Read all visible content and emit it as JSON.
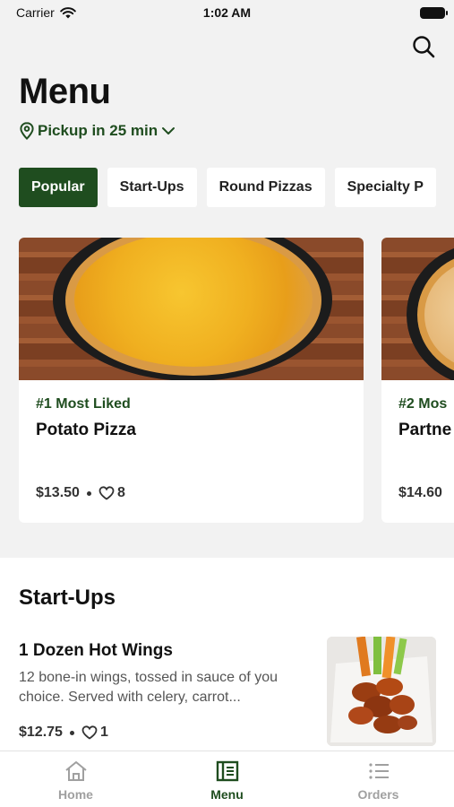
{
  "status_bar": {
    "carrier": "Carrier",
    "time": "1:02 AM"
  },
  "header": {
    "title": "Menu",
    "pickup_label": "Pickup in 25 min"
  },
  "categories": [
    {
      "label": "Popular",
      "active": true
    },
    {
      "label": "Start-Ups",
      "active": false
    },
    {
      "label": "Round Pizzas",
      "active": false
    },
    {
      "label": "Specialty P",
      "active": false
    }
  ],
  "featured": [
    {
      "rank": "#1 Most Liked",
      "name": "Potato Pizza",
      "price": "$13.50",
      "likes": "8"
    },
    {
      "rank": "#2 Mos",
      "name": "Partne",
      "price": "$14.60",
      "likes": ""
    }
  ],
  "section": {
    "title": "Start-Ups",
    "items": [
      {
        "name": "1 Dozen Hot Wings",
        "description": "12 bone-in wings, tossed in sauce of you choice. Served with celery, carrot...",
        "price": "$12.75",
        "likes": "1"
      }
    ]
  },
  "tabs": [
    {
      "label": "Home",
      "icon": "home-icon",
      "active": false
    },
    {
      "label": "Menu",
      "icon": "menu-book-icon",
      "active": true
    },
    {
      "label": "Orders",
      "icon": "list-icon",
      "active": false
    }
  ],
  "colors": {
    "brand_green": "#1f4d1f",
    "background": "#f2f2f2",
    "inactive": "#a0a0a0"
  }
}
